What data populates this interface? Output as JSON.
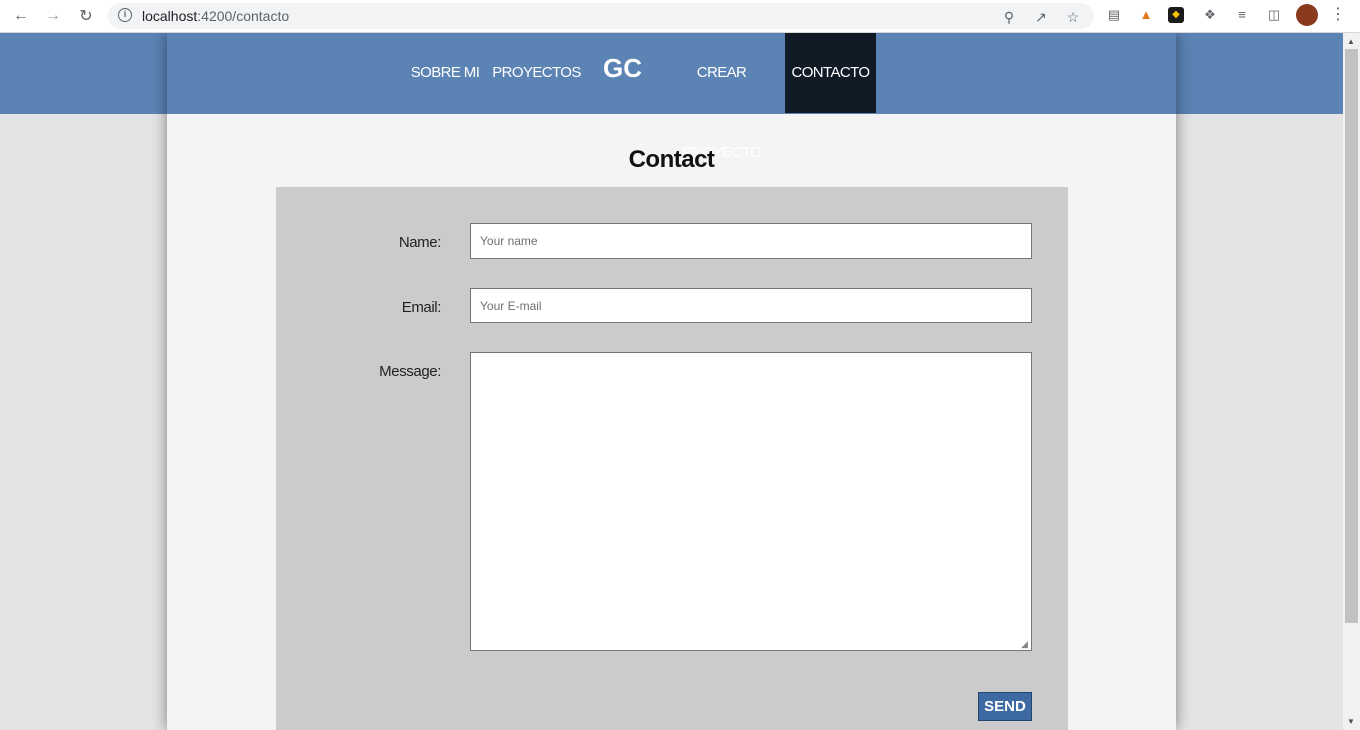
{
  "browser": {
    "url_host": "localhost",
    "url_rest": ":4200/contacto"
  },
  "nav": {
    "items": [
      {
        "label": "SOBRE MI"
      },
      {
        "label": "PROYECTOS"
      },
      {
        "label": "CREAR PROYECTO"
      },
      {
        "label": "CONTACTO",
        "active": true
      }
    ],
    "logo": "GC"
  },
  "contact": {
    "title": "Contact",
    "name_label": "Name:",
    "name_placeholder": "Your name",
    "email_label": "Email:",
    "email_placeholder": "Your E-mail",
    "message_label": "Message:",
    "send_label": "SEND"
  },
  "colors": {
    "navbar": "#5b83b4",
    "nav_active": "#111b26",
    "form_bg": "#cbcbcb",
    "send_button": "#3d6aa2"
  }
}
